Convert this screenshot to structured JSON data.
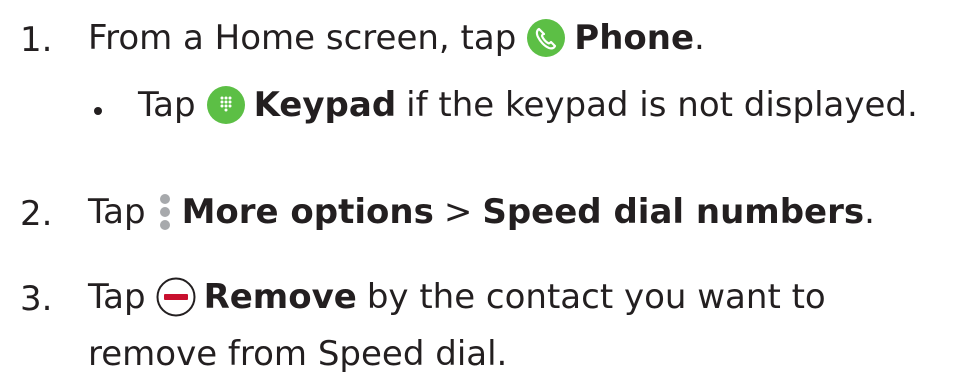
{
  "steps": [
    {
      "number": "1.",
      "before": "From a Home screen, tap",
      "icon": "phone-icon",
      "bold": "Phone",
      "after": "."
    },
    {
      "bullet": {
        "before": "Tap",
        "icon": "keypad-icon",
        "bold": "Keypad",
        "after": "if the keypad is not displayed."
      }
    },
    {
      "number": "2.",
      "before": "Tap",
      "icon": "more-options-icon",
      "bold": "More options",
      "separator": ">",
      "bold2": "Speed dial numbers",
      "after": "."
    },
    {
      "number": "3.",
      "before": "Tap",
      "icon": "remove-icon",
      "bold": "Remove",
      "after": "by the contact you want to",
      "line2": "remove from Speed dial."
    }
  ],
  "colors": {
    "text": "#231f20",
    "icon_green": "#5cbf45",
    "icon_gray": "#a7a9ac",
    "remove_red": "#c8102e"
  }
}
